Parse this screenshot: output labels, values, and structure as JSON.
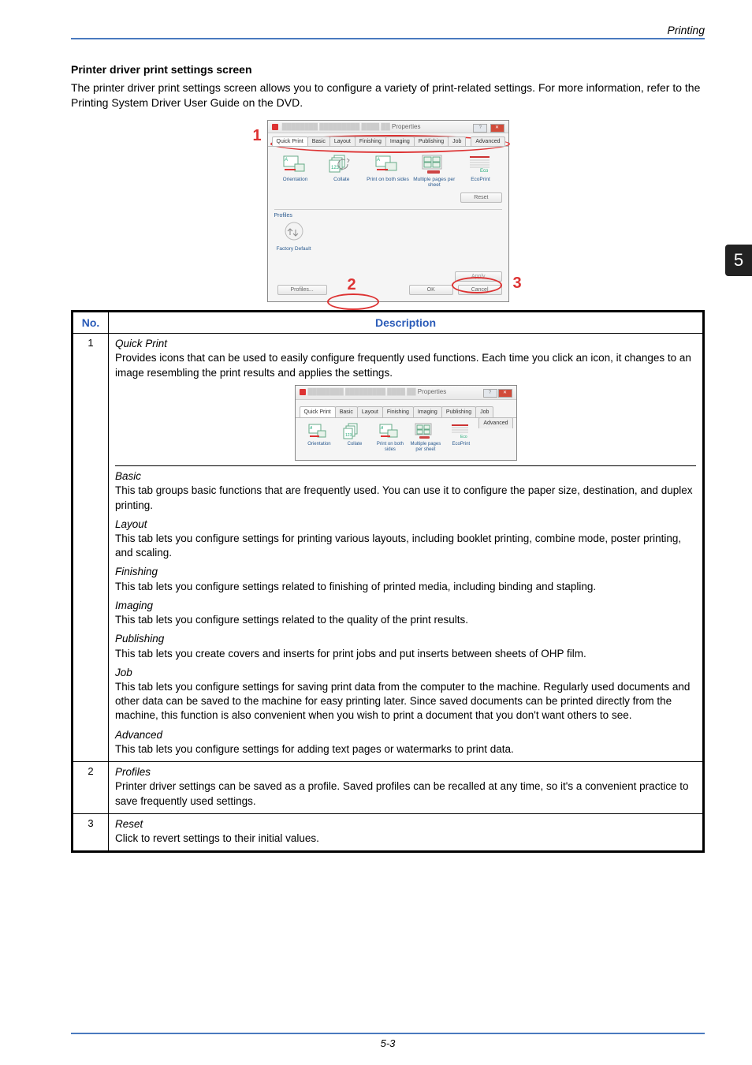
{
  "header": {
    "running": "Printing"
  },
  "sidepage": "5",
  "section": {
    "title": "Printer driver print settings screen",
    "intro": "The printer driver print settings screen allows you to configure a variety of print-related settings. For more information, refer to the Printing System Driver User Guide on the DVD."
  },
  "dialog": {
    "title_suffix": " Properties",
    "tabs": [
      "Quick Print",
      "Basic",
      "Layout",
      "Finishing",
      "Imaging",
      "Publishing",
      "Job",
      "Advanced"
    ],
    "icons": {
      "orientation": "Orientation",
      "collate": "Collate",
      "duplex": "Print on both sides",
      "nup": "Multiple pages per sheet",
      "eco": "EcoPrint"
    },
    "reset": "Reset",
    "profiles_lbl": "Profiles",
    "factory": "Factory Default",
    "apply": "Apply",
    "ok": "OK",
    "cancel": "Cancel",
    "profiles_btn": "Profiles..."
  },
  "labels": {
    "one": "1",
    "two": "2",
    "three": "3"
  },
  "table": {
    "h_no": "No.",
    "h_desc": "Description",
    "rows": [
      {
        "no": "1",
        "blocks": [
          {
            "title": "Quick Print",
            "text": "Provides icons that can be used to easily configure frequently used functions. Each time you click an icon, it changes to an image resembling the print results and applies the settings."
          },
          {
            "title": "Basic",
            "text": "This tab groups basic functions that are frequently used. You can use it to configure the paper size, destination, and duplex printing.",
            "hr": true
          },
          {
            "title": "Layout",
            "text": "This tab lets you configure settings for printing various layouts, including booklet printing, combine mode, poster printing, and scaling."
          },
          {
            "title": "Finishing",
            "text": "This tab lets you configure settings related to finishing of printed media, including binding and stapling."
          },
          {
            "title": "Imaging",
            "text": "This tab lets you configure settings related to the quality of the print results."
          },
          {
            "title": "Publishing",
            "text": "This tab lets you create covers and inserts for print jobs and put inserts between sheets of OHP film."
          },
          {
            "title": "Job",
            "text": "This tab lets you configure settings for saving print data from the computer to the machine. Regularly used documents and other data can be saved to the machine for easy printing later. Since saved documents can be printed directly from the machine, this function is also convenient when you wish to print a document that you don't want others to see."
          },
          {
            "title": "Advanced",
            "text": "This tab lets you configure settings for adding text pages or watermarks to print data."
          }
        ]
      },
      {
        "no": "2",
        "blocks": [
          {
            "title": "Profiles",
            "text": "Printer driver settings can be saved as a profile. Saved profiles can be recalled at any time, so it's a convenient practice to save frequently used settings."
          }
        ]
      },
      {
        "no": "3",
        "blocks": [
          {
            "title": "Reset",
            "text": "Click to revert settings to their initial values."
          }
        ]
      }
    ]
  },
  "footer": "5-3"
}
